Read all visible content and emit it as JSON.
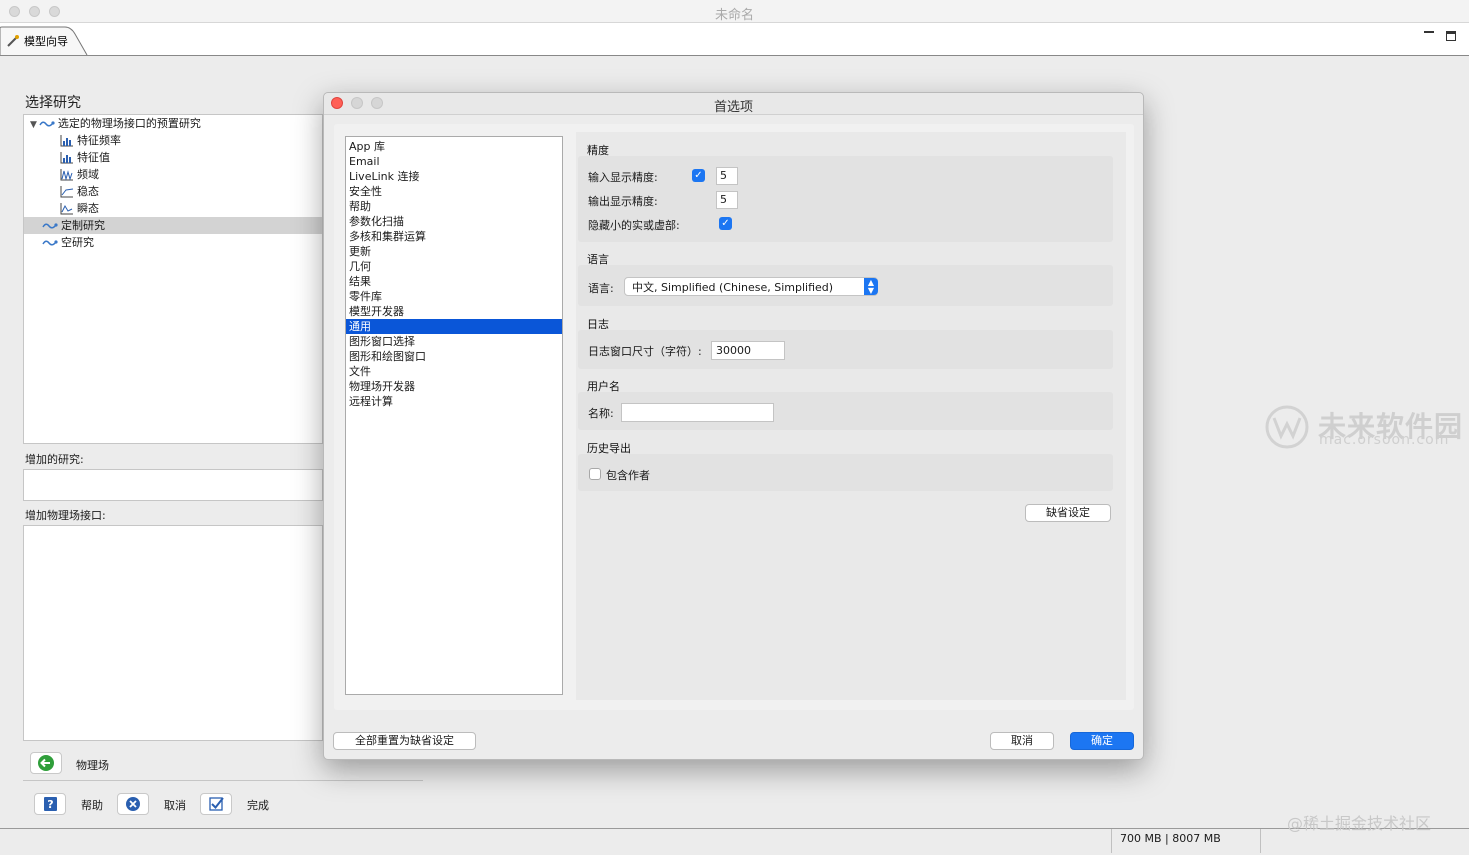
{
  "window": {
    "title": "未命名"
  },
  "tab": {
    "label": "模型向导"
  },
  "wizard": {
    "section_title": "选择研究",
    "tree": [
      {
        "label": "选定的物理场接口的预置研究",
        "level": 0,
        "expander": "▼",
        "icon": "study-icon"
      },
      {
        "label": "特征频率",
        "level": 1,
        "icon": "bar-chart-icon"
      },
      {
        "label": "特征值",
        "level": 1,
        "icon": "bar-chart-icon"
      },
      {
        "label": "频域",
        "level": 1,
        "icon": "frequency-icon"
      },
      {
        "label": "稳态",
        "level": 1,
        "icon": "stationary-icon"
      },
      {
        "label": "瞬态",
        "level": 1,
        "icon": "transient-icon"
      },
      {
        "label": "定制研究",
        "level": 0,
        "icon": "study-icon",
        "selected": true
      },
      {
        "label": "空研究",
        "level": 0,
        "icon": "study-icon"
      }
    ],
    "added_study_label": "增加的研究:",
    "added_physics_label": "增加物理场接口:",
    "physics_button_label": "物理场",
    "help_label": "帮助",
    "cancel_label": "取消",
    "done_label": "完成"
  },
  "status": {
    "memory": "700 MB | 8007 MB"
  },
  "watermarks": {
    "site": "未来软件园",
    "url": "mac.orsoon.com",
    "credit": "@稀土掘金技术社区"
  },
  "dialog": {
    "title": "首选项",
    "categories": [
      "App 库",
      "Email",
      "LiveLink 连接",
      "安全性",
      "帮助",
      "参数化扫描",
      "多核和集群运算",
      "更新",
      "几何",
      "结果",
      "零件库",
      "模型开发器",
      "通用",
      "图形窗口选择",
      "图形和绘图窗口",
      "文件",
      "物理场开发器",
      "远程计算"
    ],
    "selected_category": "通用",
    "precision": {
      "title": "精度",
      "input_label": "输入显示精度:",
      "input_checked": true,
      "input_value": "5",
      "output_label": "输出显示精度:",
      "output_value": "5",
      "hide_small_label": "隐藏小的实或虚部:",
      "hide_small_checked": true
    },
    "language": {
      "title": "语言",
      "label": "语言:",
      "value": "中文, Simplified (Chinese, Simplified)"
    },
    "log": {
      "title": "日志",
      "label": "日志窗口尺寸（字符）:",
      "value": "30000"
    },
    "username": {
      "title": "用户名",
      "label": "名称:",
      "value": "",
      "placeholder": ""
    },
    "history": {
      "title": "历史导出",
      "include_author_label": "包含作者",
      "include_author_checked": false
    },
    "defaults_button": "缺省设定",
    "reset_all_button": "全部重置为缺省设定",
    "cancel_button": "取消",
    "ok_button": "确定"
  }
}
